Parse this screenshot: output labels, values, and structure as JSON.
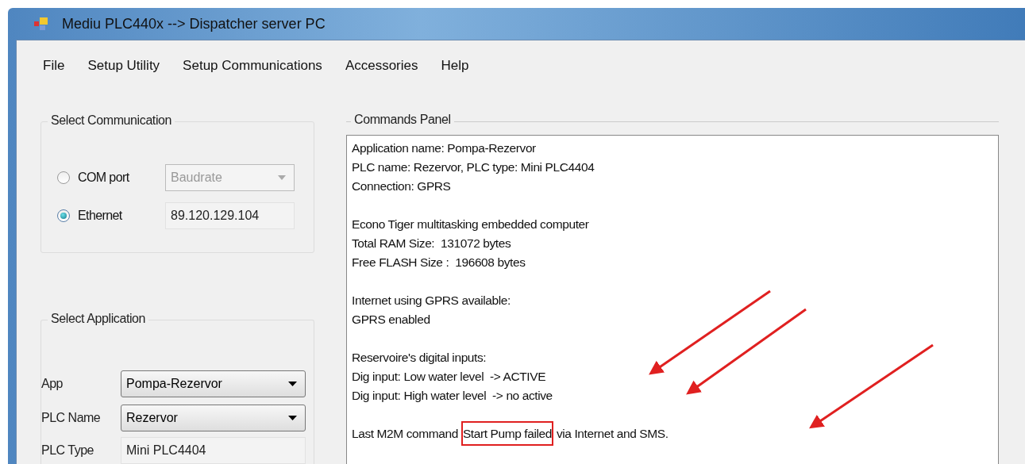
{
  "window": {
    "title": "Mediu PLC440x --> Dispatcher server PC"
  },
  "menu": [
    "File",
    "Setup Utility",
    "Setup Communications",
    "Accessories",
    "Help"
  ],
  "communication": {
    "title": "Select Communication",
    "options": [
      {
        "label": "COM port",
        "selected": false,
        "field": {
          "kind": "combo",
          "value": "Baudrate",
          "disabled": true
        }
      },
      {
        "label": "Ethernet",
        "selected": true,
        "field": {
          "kind": "text",
          "value": "89.120.129.104",
          "disabled": false
        }
      }
    ]
  },
  "application": {
    "title": "Select Application",
    "fields": [
      {
        "label": "App",
        "kind": "combo",
        "value": "Pompa-Rezervor"
      },
      {
        "label": "PLC Name",
        "kind": "combo",
        "value": "Rezervor"
      },
      {
        "label": "PLC Type",
        "kind": "text",
        "value": "Mini PLC4404"
      }
    ]
  },
  "commands_panel": {
    "title": "Commands Panel",
    "blocks": [
      [
        "Application name: Pompa-Rezervor",
        "PLC name: Rezervor, PLC type: Mini PLC4404",
        "Connection: GPRS"
      ],
      [
        "Econo Tiger multitasking embedded computer",
        "Total RAM Size:  131072 bytes",
        "Free FLASH Size :  196608 bytes"
      ],
      [
        "Internet using GPRS available:",
        "GPRS enabled"
      ],
      [
        "Reservoire's digital inputs:",
        "Dig input: Low water level  -> ACTIVE",
        "Dig input: High water level  -> no active"
      ]
    ],
    "last_command": {
      "before": "Last M2M command",
      "highlighted": "Start Pump failed",
      "after": "via Internet and SMS."
    }
  }
}
